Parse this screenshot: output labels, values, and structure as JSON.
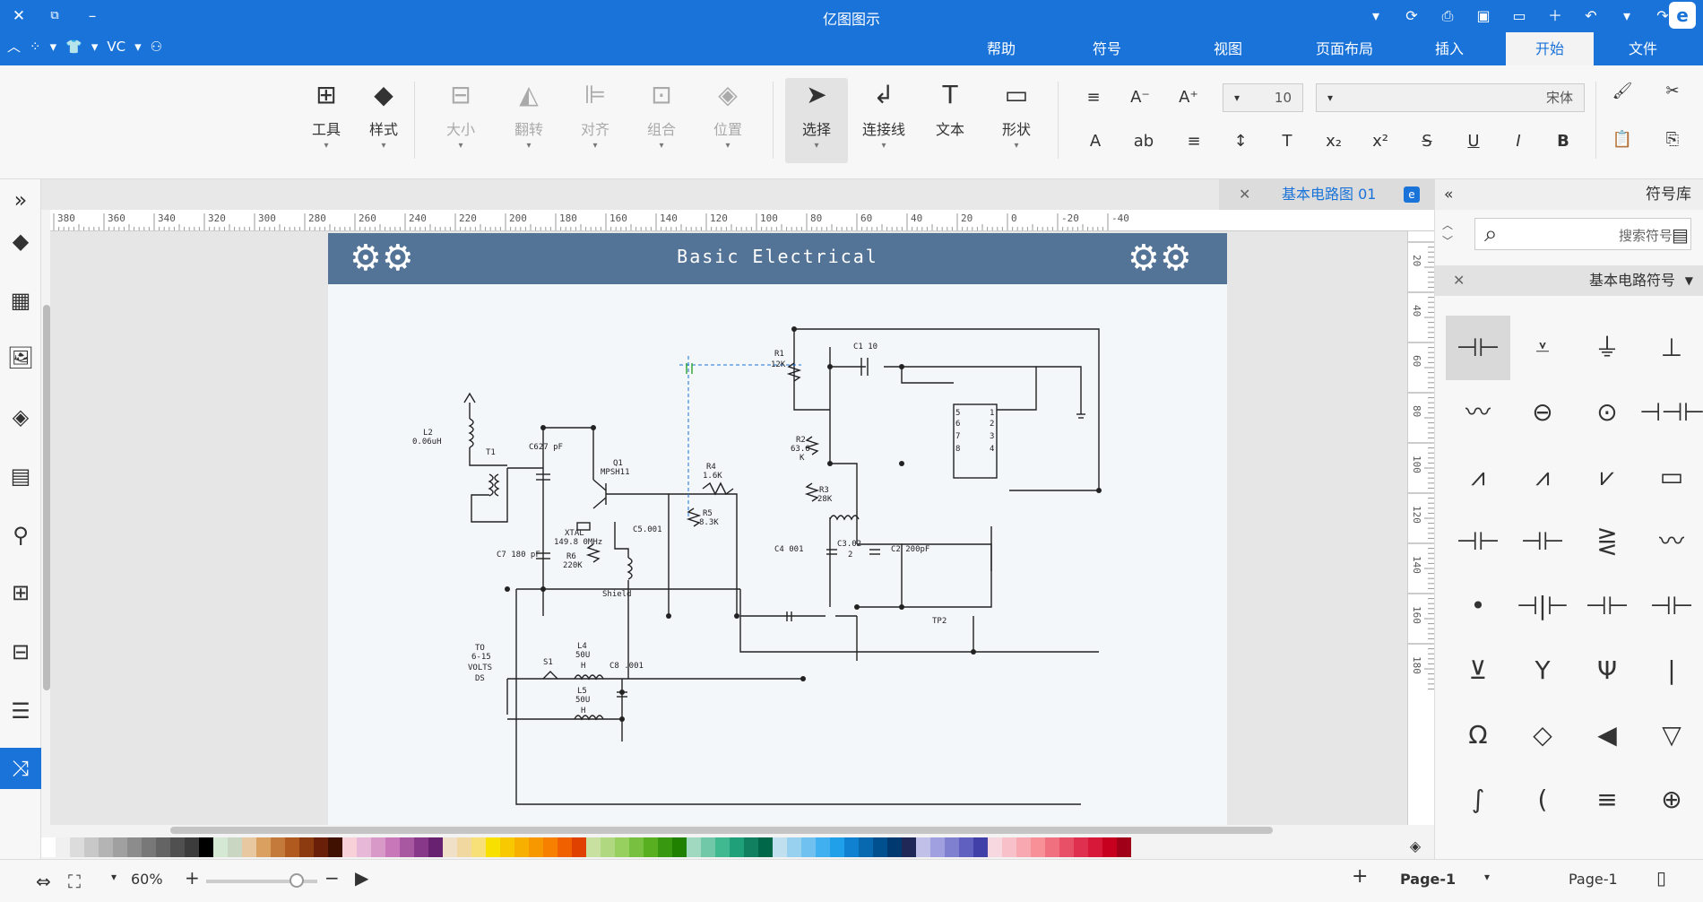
{
  "app": {
    "title": "亿图图示",
    "brand_glyph": "e"
  },
  "window": {
    "close": "✕",
    "restore": "⧉",
    "minimize": "–"
  },
  "quick_access": [
    "▾",
    "⟳",
    "⎙",
    "▣",
    "▭",
    "＋",
    "↶",
    "▾",
    "↷"
  ],
  "menubar": {
    "tabs": [
      "文件",
      "开始",
      "插入",
      "页面布局",
      "视图",
      "符号",
      "帮助"
    ],
    "active": "开始",
    "left_tools": [
      "︿",
      "⁘",
      "▾",
      "👕",
      "▾",
      "VC",
      "▾",
      "⚇"
    ]
  },
  "ribbon": {
    "clipboard": {
      "cut": "✂",
      "copy": "⎘",
      "format_painter": "🖌",
      "paste": "📋"
    },
    "font": {
      "name": "宋体",
      "size": "10"
    },
    "format_buttons": [
      "B",
      "I",
      "U",
      "S",
      "x²",
      "x₂",
      "T",
      "↕",
      "≡",
      "ab",
      "A"
    ],
    "size_buttons": [
      "A⁺",
      "A⁻",
      "≡"
    ],
    "big_buttons": [
      {
        "label": "形状",
        "icon": "▭",
        "state": "normal"
      },
      {
        "label": "文本",
        "icon": "T",
        "state": "normal"
      },
      {
        "label": "连接线",
        "icon": "↲",
        "state": "normal"
      },
      {
        "label": "选择",
        "icon": "➤",
        "state": "selected"
      },
      {
        "label": "位置",
        "icon": "◈",
        "state": "disabled"
      },
      {
        "label": "组合",
        "icon": "⊡",
        "state": "disabled"
      },
      {
        "label": "对齐",
        "icon": "⊫",
        "state": "disabled"
      },
      {
        "label": "翻转",
        "icon": "◭",
        "state": "disabled"
      },
      {
        "label": "大小",
        "icon": "⊟",
        "state": "disabled"
      },
      {
        "label": "样式",
        "icon": "◆",
        "state": "normal"
      },
      {
        "label": "工具",
        "icon": "⊞",
        "state": "normal"
      }
    ]
  },
  "left_sidebar": [
    "»",
    "◆",
    "▦",
    "🖼",
    "◈",
    "▤",
    "⚲",
    "⊞",
    "⊟",
    "☰",
    "⤨"
  ],
  "document": {
    "tab_label": "基本电路图 01",
    "close": "✕",
    "page_title": "Basic Electrical",
    "ruler_h": [
      "-40",
      "-20",
      "0",
      "20",
      "40",
      "60",
      "80",
      "100",
      "120",
      "140",
      "160",
      "180",
      "200",
      "220",
      "240",
      "260",
      "280",
      "300",
      "320",
      "340",
      "360",
      "380"
    ],
    "ruler_v": [
      "20",
      "40",
      "60",
      "80",
      "100",
      "120",
      "140",
      "160",
      "180"
    ]
  },
  "circuit_labels": {
    "r1": "R1",
    "r1v": "12K",
    "c1": "C1 10",
    "r2": "R2",
    "r2v": "63.6",
    "r2k": "K",
    "r3": "R3",
    "r3v": "28K",
    "c2": "C2 200pF",
    "c3": "C3.02",
    "c3v": "2",
    "c4": "C4 001",
    "r4": "R4",
    "r4v": "1.6K",
    "r5": "R5",
    "r5v": "8.3K",
    "c5": "C5.001",
    "q1": "Q1",
    "q1v": "MPSH11",
    "xtal": "XTAL",
    "xtalv": "149.8 0MHz",
    "r6": "R6",
    "r6v": "220K",
    "c6": "C627 pF",
    "c7": "C7 180 pF",
    "t1": "T1",
    "l2": "L2",
    "l2v": "0.06uH",
    "shield": "Shield",
    "tp2": "TP2",
    "l4": "L4",
    "l4v": "50U",
    "l4h": "H",
    "l5": "L5",
    "l5v": "50U",
    "l5h": "H",
    "s1": "S1",
    "c8": "C8 .001",
    "to": "TO",
    "tov": "6-15",
    "volts": "VOLTS",
    "ds": "DS",
    "ic_pins": [
      "1",
      "2",
      "3",
      "4",
      "5",
      "6",
      "7",
      "8"
    ]
  },
  "right_panel": {
    "title": "符号库",
    "collapse": "«",
    "search_placeholder": "搜索符号",
    "category": "基本电路符号",
    "symbols": [
      "⊣⊢",
      "⩡",
      "⏚",
      "⊥",
      "〰",
      "⊖",
      "⊙",
      "⊣⊣⊢⊢",
      "⩘",
      "⩘",
      "⩗",
      "▭",
      "⊣⊢",
      "⊣⊢",
      "⋛",
      "〰",
      "•",
      "⊣|⊢",
      "⊣⊢",
      "⊣⊢",
      "⊻",
      "Y",
      "Ψ",
      "|",
      "Ω",
      "◇",
      "◀",
      "▽",
      "∫",
      "(",
      "≡",
      "⊕"
    ]
  },
  "statusbar": {
    "page_label": "Page-1",
    "page_tab": "Page-1",
    "add": "+",
    "zoom": "60%",
    "zoom_minus": "−",
    "zoom_plus": "+",
    "play": "▶"
  },
  "colors": {
    "accent": "#1a73d9",
    "header_bg": "#547497",
    "palette": [
      "#ffffff",
      "#f0f0f0",
      "#dcdcdc",
      "#c8c8c8",
      "#b4b4b4",
      "#a0a0a0",
      "#8c8c8c",
      "#787878",
      "#646464",
      "#505050",
      "#3c3c3c",
      "#000000",
      "#d4e8d4",
      "#c9d6c2",
      "#e8c8a0",
      "#d9a060",
      "#c47a3a",
      "#b05a20",
      "#8c3a10",
      "#6a2008",
      "#401000",
      "#f8d0d8",
      "#e8b8d8",
      "#d898c8",
      "#c878b8",
      "#a858a0",
      "#883888",
      "#682070",
      "#f0e0c8",
      "#f0d8a0",
      "#f8e078",
      "#f8e000",
      "#f8c800",
      "#f8b000",
      "#f89800",
      "#f88000",
      "#f06000",
      "#e04000",
      "#c8e0a0",
      "#b0d880",
      "#98d060",
      "#78c040",
      "#58b020",
      "#389810",
      "#208000",
      "#a0d8c0",
      "#70c8a8",
      "#40b890",
      "#20a078",
      "#108060",
      "#006848",
      "#c0e0f0",
      "#98d0f0",
      "#70c0f0",
      "#40b0f0",
      "#20a0e8",
      "#1080d0",
      "#0868b0",
      "#005090",
      "#003870",
      "#202858",
      "#c0c0e8",
      "#a0a0e0",
      "#8080d0",
      "#6060c0",
      "#4040a8",
      "#f8d8e0",
      "#f8c0c8",
      "#f8a8b0",
      "#f89098",
      "#f07080",
      "#e85068",
      "#e03050",
      "#d81838",
      "#c80020",
      "#a00018"
    ]
  }
}
